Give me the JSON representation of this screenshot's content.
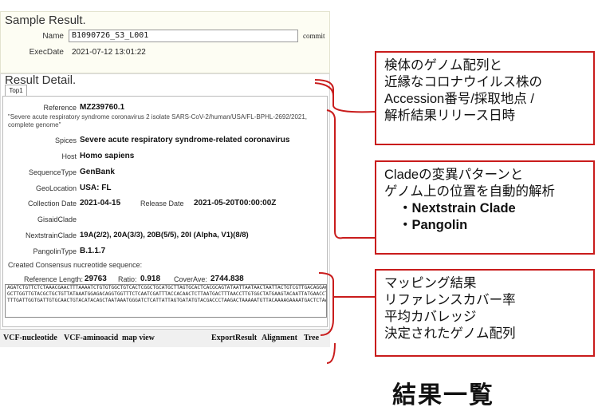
{
  "sample_result": {
    "title": "Sample Result.",
    "name_label": "Name",
    "name_value": "B1090726_S3_L001",
    "commit_label": "commit",
    "execdate_label": "ExecDate",
    "execdate_value": "2021-07-12 13:01:22"
  },
  "result_detail": {
    "title": "Result Detail.",
    "tab_label": "Top1",
    "reference_label": "Reference",
    "reference_value": "MZ239760.1",
    "reference_desc": "\"Severe acute respiratory syndrome coronavirus 2 isolate SARS-CoV-2/human/USA/FL-BPHL-2692/2021, complete genome\"",
    "species_label": "Spices",
    "species_value": "Severe acute respiratory syndrome-related coronavirus",
    "host_label": "Host",
    "host_value": "Homo sapiens",
    "seqtype_label": "SequenceType",
    "seqtype_value": "GenBank",
    "geo_label": "GeoLocation",
    "geo_value": "USA: FL",
    "collection_label": "Collection Date",
    "collection_value": "2021-04-15",
    "release_label": "Release Date",
    "release_value": "2021-05-20T00:00:00Z",
    "gisaid_label": "GisaidClade",
    "gisaid_value": "",
    "nextstrain_label": "NextstrainClade",
    "nextstrain_value": "19A(2/2), 20A(3/3), 20B(5/5), 20I (Alpha, V1)(8/8)",
    "pangolin_label": "PangolinType",
    "pangolin_value": "B.1.1.7",
    "consensus_label": "Created Consensus nucreotide sequence:",
    "reflen_label": "Reference Length:",
    "reflen_value": "29763",
    "ratio_label": "Ratio:",
    "ratio_value": "0.918",
    "coverave_label": "CoverAve:",
    "coverave_value": "2744.838",
    "sequence_lines": [
      "AGATCTGTTCTCTAAACGAACTTTAAAATCTGTGTGGCTGTCACTCGGCTGCATGCTTAGTGCACTCACGCAGTATAATTAATAACTAATTACTGTCGTTGACAGGACACGAGTAACTCGTCTATCTTC",
      "GCTTGGTTGTACGCTGCTGTTATAAATGGAGACAGGTGGTTTCTCAATCGATTTACCACAACTCTTAATGACTTTAACCTTGTGGCTATGAAGTACAATTATGAACCTCTAACACAAGACCATGTTGAC",
      "TTTGATTGGTGATTGTGCAACTGTACATACAGCTAATAAATGGGATCTCATTATTAGTGATATGTACGACCCTAAGACTAAAAATGTTACAAAAGAAAATGACTCTAAAGAGGGTTTTTTCACTTACATT"
    ]
  },
  "bottom_bar": {
    "vcf_nucleotide": "VCF-nucleotide",
    "vcf_aminoacid": "VCF-aminoacid",
    "map_view": "map view",
    "export_result": "ExportResult",
    "alignment": "Alignment",
    "tree": "Tree"
  },
  "callouts": {
    "box1": [
      "検体のゲノム配列と",
      "近縁なコロナウイルス株の",
      "Accession番号/採取地点 /",
      "解析結果リリース日時"
    ],
    "box2": {
      "lines": [
        "Cladeの変異パターンと",
        "ゲノム上の位置を自動的解析"
      ],
      "bullets": [
        "・Nextstrain Clade",
        "・Pangolin"
      ]
    },
    "box3": [
      "マッピング結果",
      "リファレンスカバー率",
      "平均カバレッジ",
      "決定されたゲノム配列"
    ]
  },
  "summary_title": "結果一覧",
  "colors": {
    "accent_red": "#c91c1c",
    "panel_bg": "#fdfdf3"
  }
}
